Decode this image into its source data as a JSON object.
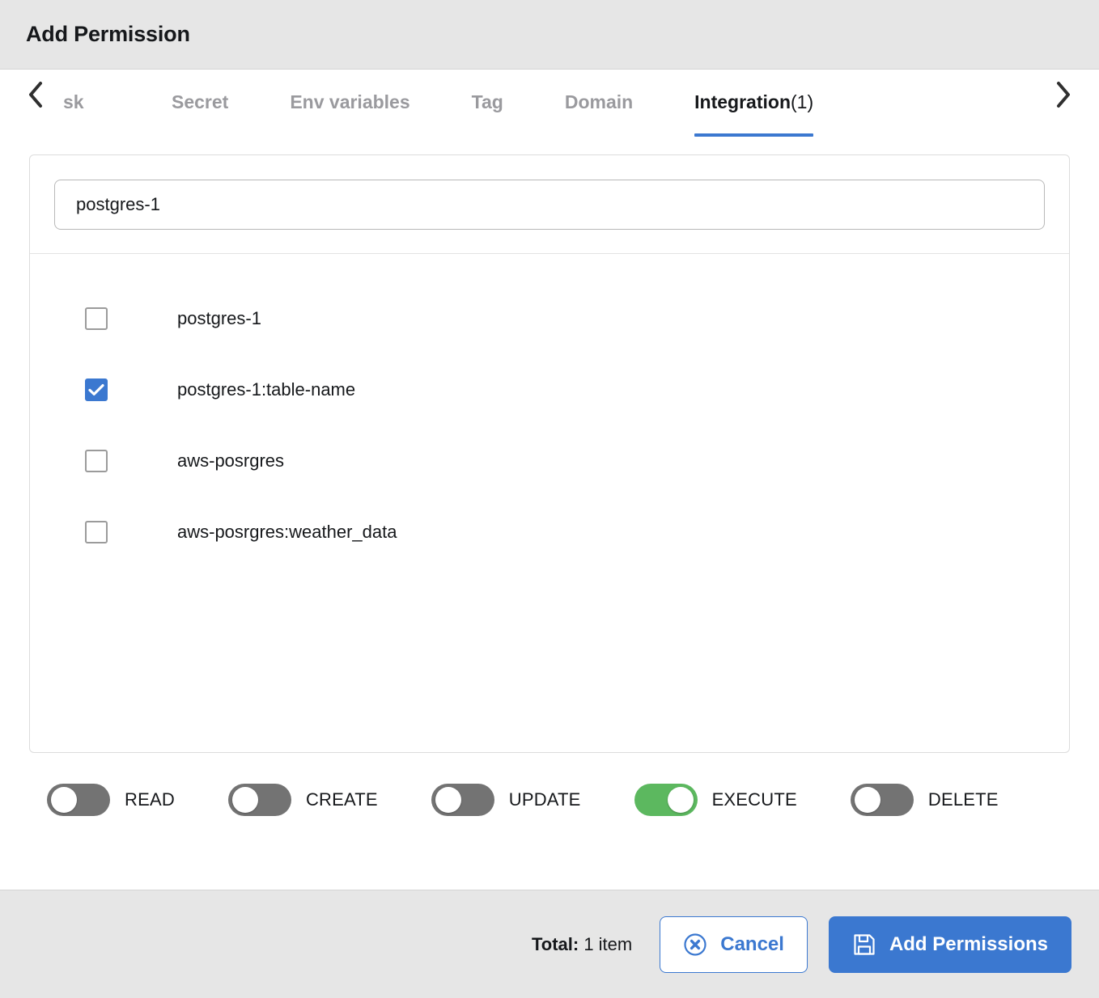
{
  "header": {
    "title": "Add Permission"
  },
  "tabs": {
    "prev_label": "chevron-left",
    "next_label": "chevron-right",
    "items": [
      {
        "label": "sk",
        "active": false,
        "clipped": true
      },
      {
        "label": "Secret",
        "active": false,
        "clipped": false
      },
      {
        "label": "Env variables",
        "active": false,
        "clipped": false
      },
      {
        "label": "Tag",
        "active": false,
        "clipped": false
      },
      {
        "label": "Domain",
        "active": false,
        "clipped": false
      },
      {
        "label": "Integration",
        "count": " (1)",
        "active": true,
        "clipped": false
      }
    ],
    "active_underline_color": "#3b78d0"
  },
  "search": {
    "value": "postgres-1",
    "placeholder": "Search"
  },
  "options": [
    {
      "label": "postgres-1",
      "checked": false
    },
    {
      "label": "postgres-1:table-name",
      "checked": true
    },
    {
      "label": "aws-posrgres",
      "checked": false
    },
    {
      "label": "aws-posrgres:weather_data",
      "checked": false
    }
  ],
  "permissions": [
    {
      "label": "READ",
      "on": false
    },
    {
      "label": "CREATE",
      "on": false
    },
    {
      "label": "UPDATE",
      "on": false
    },
    {
      "label": "EXECUTE",
      "on": true
    },
    {
      "label": "DELETE",
      "on": false
    }
  ],
  "footer": {
    "total_label": "Total:",
    "total_value": " 1 item",
    "cancel_label": "Cancel",
    "submit_label": "Add Permissions"
  },
  "colors": {
    "accent": "#3b78d0",
    "toggle_on": "#5cb85f",
    "toggle_off": "#737373",
    "chrome": "#e6e6e6"
  }
}
